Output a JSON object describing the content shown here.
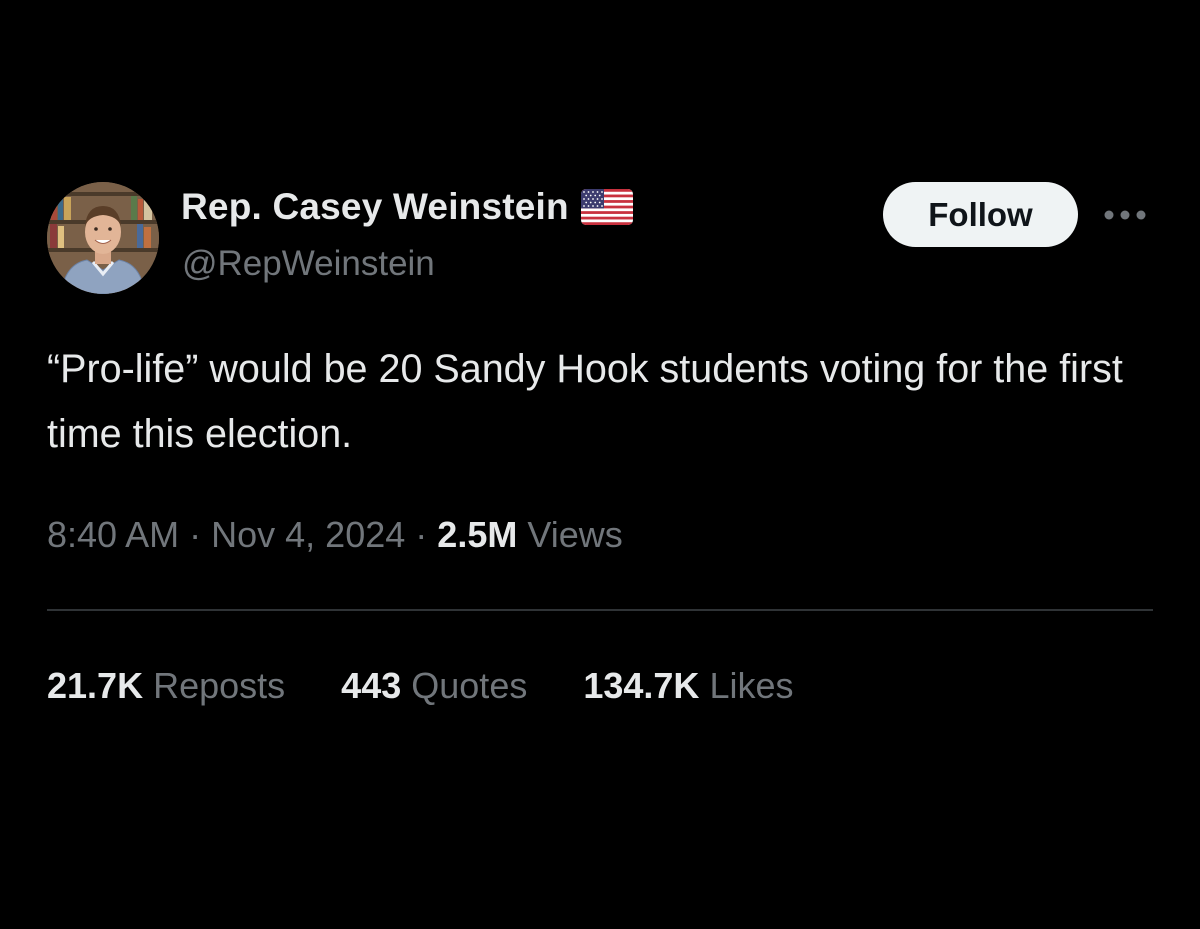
{
  "author": {
    "display_name": "Rep. Casey Weinstein",
    "handle": "@RepWeinstein",
    "flag_icon": "us-flag-icon"
  },
  "actions": {
    "follow_label": "Follow",
    "more_icon": "more-horizontal-icon"
  },
  "tweet": {
    "text": "“Pro-life” would be 20 Sandy Hook students voting for the first time this election.",
    "time": "8:40 AM",
    "separator": "·",
    "date": "Nov 4, 2024",
    "views_count": "2.5M",
    "views_label": "Views"
  },
  "stats": {
    "reposts_count": "21.7K",
    "reposts_label": "Reposts",
    "quotes_count": "443",
    "quotes_label": "Quotes",
    "likes_count": "134.7K",
    "likes_label": "Likes"
  },
  "colors": {
    "background": "#000000",
    "primary_text": "#e7e9ea",
    "secondary_text": "#71767b",
    "follow_button_bg": "#eff3f4",
    "divider": "#2f3336"
  }
}
